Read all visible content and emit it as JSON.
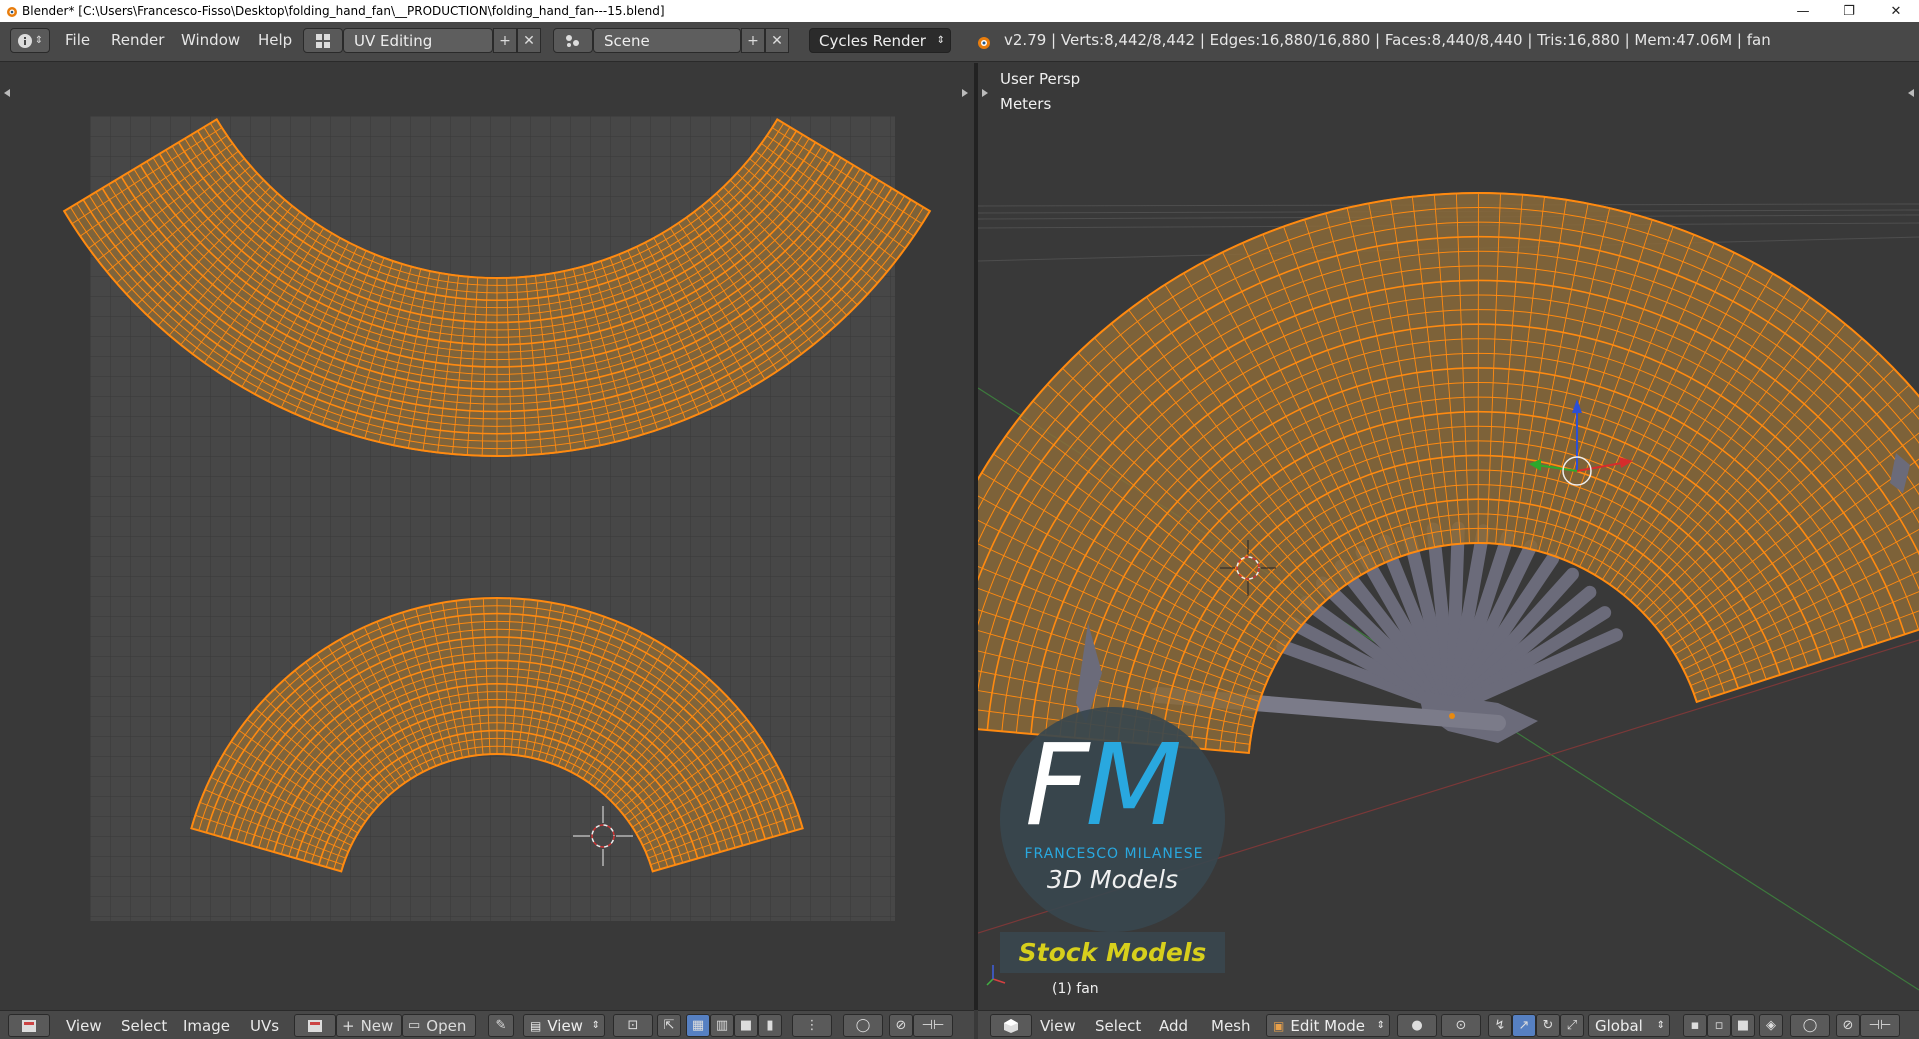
{
  "window": {
    "title": "Blender* [C:\\Users\\Francesco-Fisso\\Desktop\\folding_hand_fan\\__PRODUCTION\\folding_hand_fan---15.blend]",
    "minimize_glyph": "—",
    "maximize_glyph": "❐",
    "close_glyph": "✕"
  },
  "info_header": {
    "menus": [
      "File",
      "Render",
      "Window",
      "Help"
    ],
    "screen_layout": "UV Editing",
    "scene": "Scene",
    "render_engine": "Cycles Render",
    "stats": "v2.79 | Verts:8,442/8,442 | Edges:16,880/16,880 | Faces:8,440/8,440 | Tris:16,880 | Mem:47.06M | fan"
  },
  "viewport_3d": {
    "view_label": "User Persp",
    "units_label": "Meters",
    "object_label": "(1) fan"
  },
  "watermark": {
    "initials_f": "F",
    "initials_m": "M",
    "name": "FRANCESCO MILANESE",
    "tagline": "3D Models",
    "badge": "Stock Models"
  },
  "uv_footer": {
    "menus": [
      "View",
      "Select",
      "Image",
      "UVs"
    ],
    "new_label": "New",
    "open_label": "Open",
    "view_select": "View"
  },
  "view3d_footer": {
    "menus": [
      "View",
      "Select",
      "Add",
      "Mesh"
    ],
    "mode": "Edit Mode",
    "orientation": "Global"
  },
  "colors": {
    "mesh_edge": "#ff8a10",
    "face_fill": "#8a6a3a",
    "uv_background": "#3c3c3c",
    "viewport_background": "#393939",
    "accent_blue": "#29a8df",
    "stock_yellow": "#d7cf1c"
  }
}
